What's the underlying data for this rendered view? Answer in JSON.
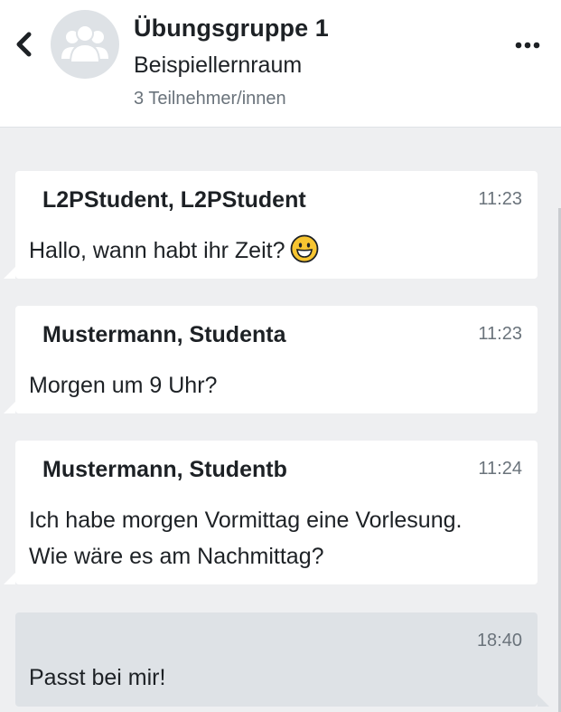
{
  "header": {
    "title": "Übungsgruppe 1",
    "subtitle": "Beispiellernraum",
    "members": "3 Teilnehmer/innen",
    "back_icon": "chevron-left-icon",
    "menu_icon": "more-horizontal-icon",
    "avatar_icon": "group-icon"
  },
  "messages": [
    {
      "sender": "L2PStudent, L2PStudent",
      "time": "11:23",
      "text": "Hallo, wann habt ihr Zeit?",
      "emoji": "grinning-face-icon"
    },
    {
      "sender": "Mustermann, Studenta",
      "time": "11:23",
      "text": "Morgen um 9 Uhr?"
    },
    {
      "sender": "Mustermann, Studentb",
      "time": "11:24",
      "text_lines": [
        "Ich habe morgen Vormittag eine Vorlesung.",
        "Wie wäre es am Nachmittag?"
      ]
    },
    {
      "time": "18:40",
      "text": "Passt bei mir!",
      "own": true
    }
  ],
  "colors": {
    "background": "#eeeff1",
    "header_bg": "#ffffff",
    "bubble_in": "#ffffff",
    "bubble_out": "#dee2e6",
    "text": "#1d2125",
    "muted": "#6a737b"
  }
}
